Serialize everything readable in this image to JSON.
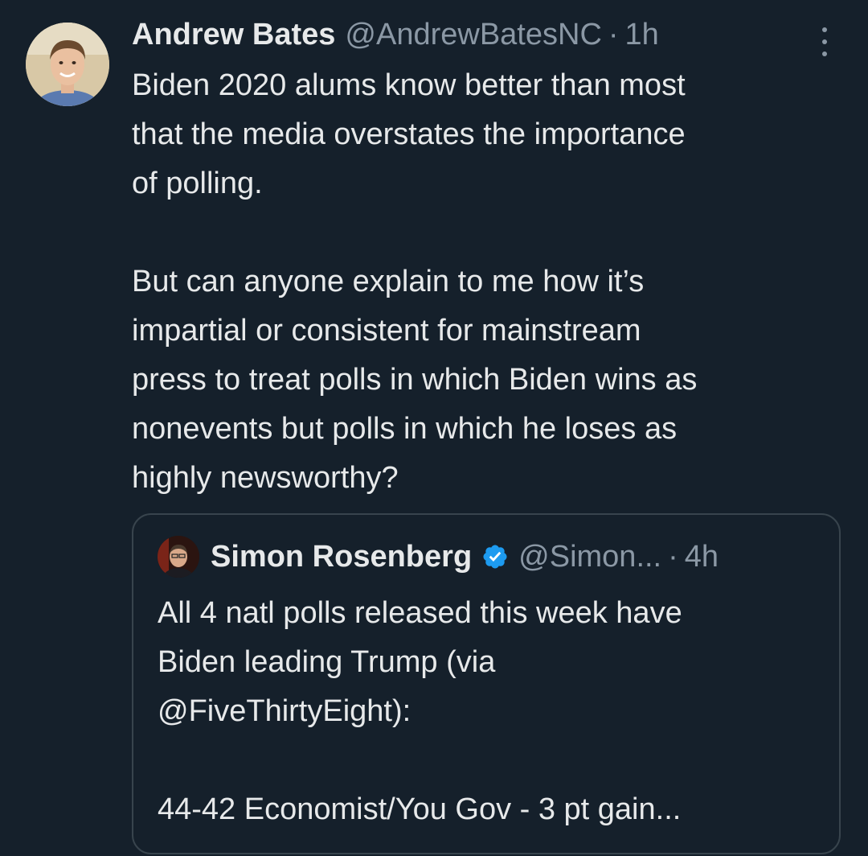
{
  "tweet": {
    "author": {
      "display_name": "Andrew Bates",
      "handle": "@AndrewBatesNC",
      "separator": "·",
      "time": "1h",
      "avatar_icon": "profile-photo"
    },
    "more_icon": "more-vertical-icon",
    "text": "Biden 2020 alums know better than most\nthat the media overstates the importance\nof polling.\n\nBut can anyone explain to me how it’s\nimpartial or consistent for mainstream\npress to treat polls in which Biden wins as\nnonevents but polls in which he loses as\nhighly newsworthy?"
  },
  "quote": {
    "author": {
      "display_name": "Simon Rosenberg",
      "verified_icon": "verified-badge-icon",
      "handle": "@Simon...",
      "separator": "·",
      "time": "4h"
    },
    "text": "All 4 natl polls released this week have\nBiden leading Trump (via\n@FiveThirtyEight):\n\n44-42 Economist/You Gov - 3 pt gain..."
  },
  "colors": {
    "background": "#15202b",
    "text_primary": "#e7e9ea",
    "text_secondary": "#8b98a5",
    "border": "#38444d",
    "verified": "#1d9bf0"
  }
}
